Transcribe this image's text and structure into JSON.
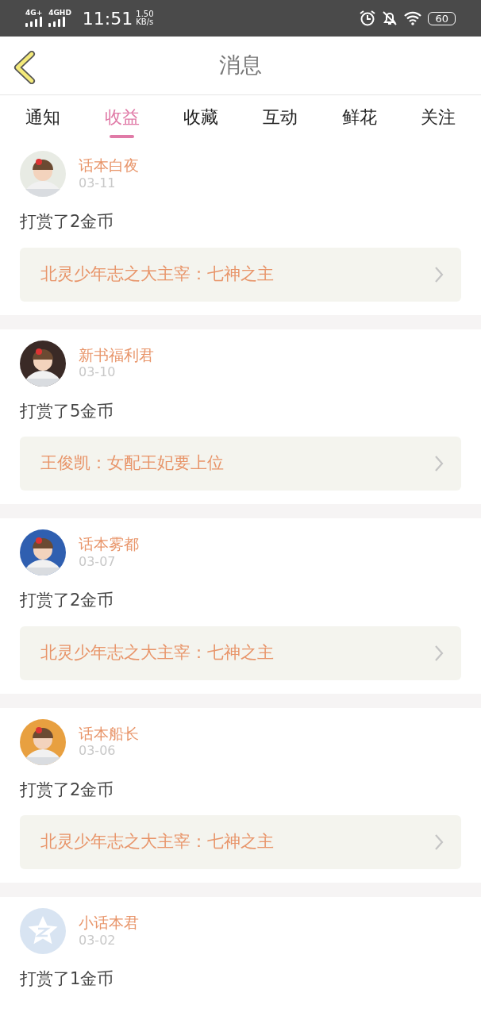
{
  "status_bar": {
    "network_1": "4G+",
    "network_2": "4GHD",
    "time": "11:51",
    "speed_value": "1.50",
    "speed_unit": "KB/s",
    "battery": "60"
  },
  "header": {
    "title": "消息"
  },
  "tabs": [
    {
      "label": "通知",
      "selected": false
    },
    {
      "label": "收益",
      "selected": true
    },
    {
      "label": "收藏",
      "selected": false
    },
    {
      "label": "互动",
      "selected": false
    },
    {
      "label": "鲜花",
      "selected": false
    },
    {
      "label": "关注",
      "selected": false
    }
  ],
  "messages": [
    {
      "kind": "picture",
      "user": "话本白夜",
      "date": "03-11",
      "text": "打赏了2金币",
      "book": "北灵少年志之大主宰：七神之主"
    },
    {
      "kind": "picture",
      "user": "新书福利君",
      "date": "03-10",
      "text": "打赏了5金币",
      "book": "王俊凯：女配王妃要上位"
    },
    {
      "kind": "picture",
      "user": "话本雾都",
      "date": "03-07",
      "text": "打赏了2金币",
      "book": "北灵少年志之大主宰：七神之主"
    },
    {
      "kind": "picture",
      "user": "话本船长",
      "date": "03-06",
      "text": "打赏了2金币",
      "book": "北灵少年志之大主宰：七神之主"
    },
    {
      "kind": "icon",
      "user": "小话本君",
      "date": "03-02",
      "text": "打赏了1金币"
    }
  ]
}
